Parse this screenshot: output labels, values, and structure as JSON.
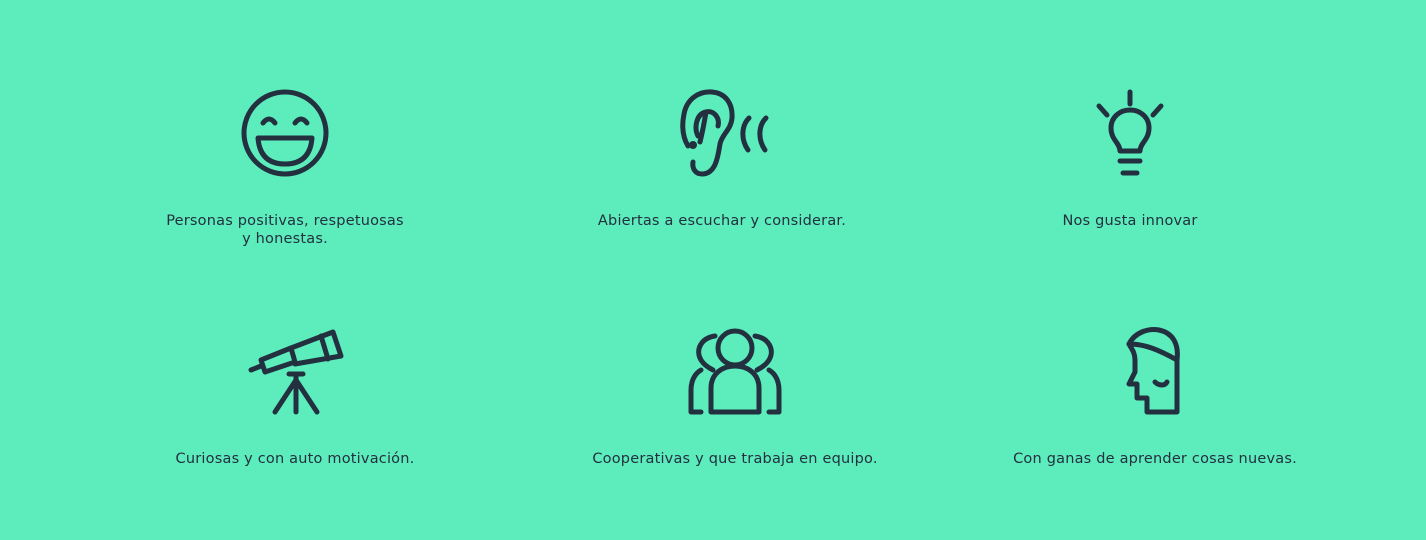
{
  "features": [
    {
      "icon": "smiley-face-icon",
      "label": "Personas positivas, respetuosas\ny honestas."
    },
    {
      "icon": "ear-listening-icon",
      "label": "Abiertas a escuchar y considerar."
    },
    {
      "icon": "lightbulb-icon",
      "label": "Nos gusta innovar"
    },
    {
      "icon": "telescope-icon",
      "label": "Curiosas y con auto motivación."
    },
    {
      "icon": "team-people-icon",
      "label": "Cooperativas y que trabaja en equipo."
    },
    {
      "icon": "open-head-icon",
      "label": "Con ganas de aprender cosas nuevas."
    }
  ],
  "colors": {
    "background": "#5dedbd",
    "ink": "#22303f"
  }
}
